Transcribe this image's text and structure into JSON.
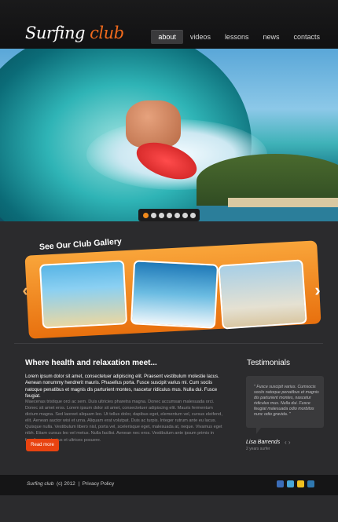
{
  "logo": {
    "part1": "Surfing",
    "part2": "club"
  },
  "nav": {
    "items": [
      "about",
      "videos",
      "lessons",
      "news",
      "contacts"
    ],
    "active": "about"
  },
  "slider": {
    "dots": 7,
    "active_index": 0
  },
  "gallery": {
    "title": "See Our Club Gallery"
  },
  "main": {
    "title": "Where health and relaxation meet...",
    "intro": "Lorem ipsum dolor sit amet, consectetuer adipiscing elit. Praesent vestibulum molestie lacus. Aenean nonummy hendrerit mauris. Phasellus porta. Fusce suscipit varius mi. Cum sociis natoque penatibus et magnis dis parturient montes, nascetur ridiculus mus. Nulla dui. Fusce feugiat.",
    "body": "Maecenas tristique orci ac sem. Duis ultricies pharetra magna. Donec accumsan malesuada orci. Donec sit amet eros. Lorem ipsum dolor sit amet, consectetuer adipiscing elit. Mauris fermentum dictum magna. Sed laoreet aliquam leo. Ut tellus dolor, dapibus eget, elementum vel, cursus eleifend, elit. Aenean auctor wisi et urna. Aliquam erat volutpat. Duis ac turpis. Integer rutrum ante eu lacus. Quisque nulla. Vestibulum libero nisl, porta vel, scelerisque eget, malesuada at, neque. Vivamus eget nibh. Etiam cursus leo vel metus. Nulla facilisi. Aenean nec eros. Vestibulum ante ipsum primis in faucibus orci luctus et ultrices posuere.",
    "read_more": "Read more"
  },
  "testimonials": {
    "title": "Testimonials",
    "quote": "\" Fusce suscipit varius. Cumsocis sociis natoque penatibus et magnis dis parturient montes, nascetur ridiculus mus. Nulla dui. Fusce feugiat malesuada odio morbitos nunc odio gravida. \"",
    "name": "Lisa Barrends",
    "role": "2 years surfer"
  },
  "footer": {
    "brand": "Surfing club",
    "year": "(c) 2012",
    "separator": "|",
    "privacy": "Privacy Policy"
  },
  "social": [
    "facebook-icon",
    "twitter-icon",
    "rss-icon",
    "linkedin-icon"
  ],
  "colors": {
    "accent": "#f06a1c",
    "gallery": "#f29a2e",
    "button": "#e84310"
  }
}
